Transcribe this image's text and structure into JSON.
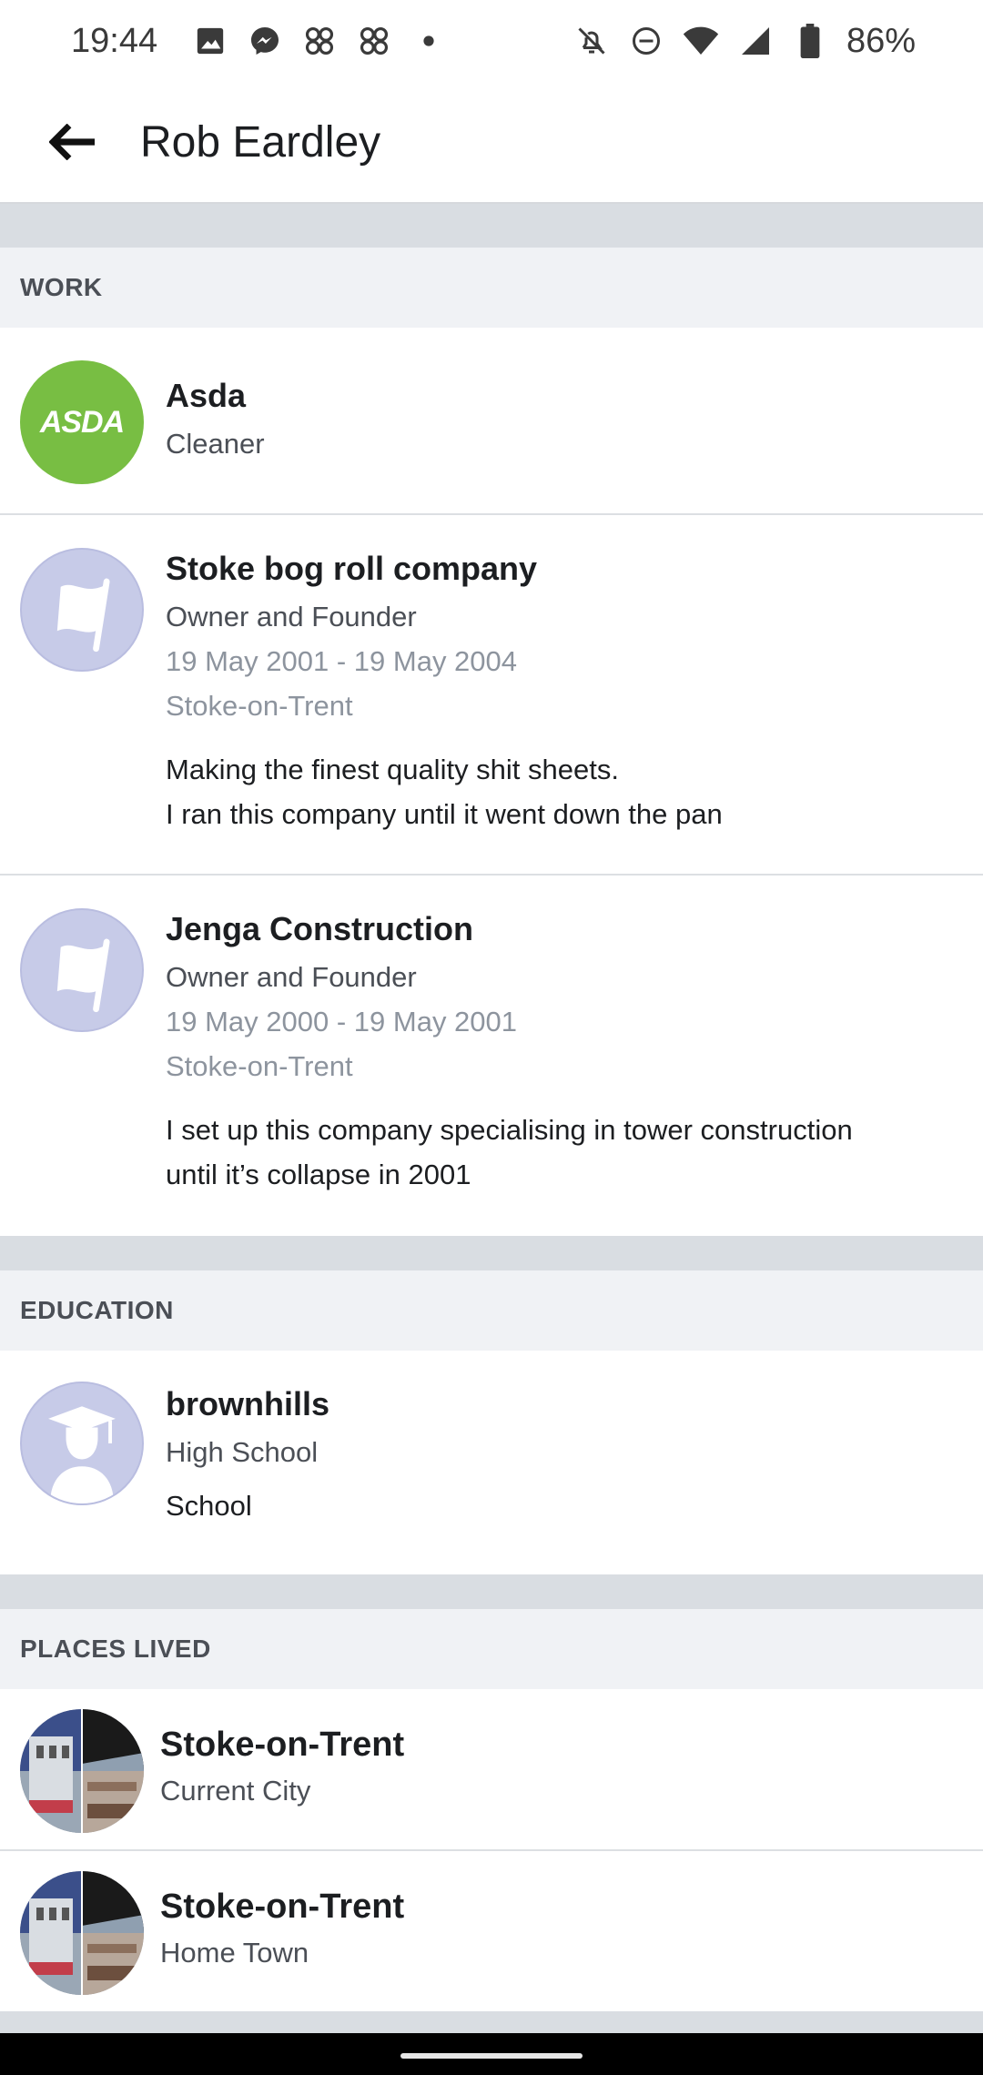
{
  "status_bar": {
    "time": "19:44",
    "battery": "86%",
    "left_icons": [
      "gallery-icon",
      "messenger-icon",
      "app-icon",
      "app-icon",
      "dot-icon"
    ],
    "right_icons": [
      "bell-off-icon",
      "dnd-icon",
      "wifi-icon",
      "signal-icon",
      "battery-icon"
    ]
  },
  "header": {
    "title": "Rob Eardley"
  },
  "work": {
    "section_label": "WORK",
    "items": [
      {
        "logo_text": "ASDA",
        "name": "Asda",
        "role": "Cleaner"
      },
      {
        "name": "Stoke bog roll company",
        "role": "Owner and Founder",
        "dates": "19 May 2001 - 19 May 2004",
        "location": "Stoke-on-Trent",
        "description_line1": "Making the finest quality shit sheets.",
        "description_line2": "I ran this company until it went down the pan"
      },
      {
        "name": "Jenga Construction",
        "role": "Owner and Founder",
        "dates": "19 May 2000 - 19 May 2001",
        "location": "Stoke-on-Trent",
        "description_line1": "I set up this company specialising in tower construction",
        "description_line2": "until it’s collapse in 2001"
      }
    ]
  },
  "education": {
    "section_label": "EDUCATION",
    "items": [
      {
        "name": "brownhills",
        "type": "High School",
        "description": "School"
      }
    ]
  },
  "places": {
    "section_label": "PLACES LIVED",
    "items": [
      {
        "name": "Stoke-on-Trent",
        "type": "Current City"
      },
      {
        "name": "Stoke-on-Trent",
        "type": "Home Town"
      }
    ]
  },
  "colors": {
    "asda_green": "#78be43",
    "placeholder_avatar": "#c7cbe8",
    "section_bg": "#f0f2f5"
  }
}
